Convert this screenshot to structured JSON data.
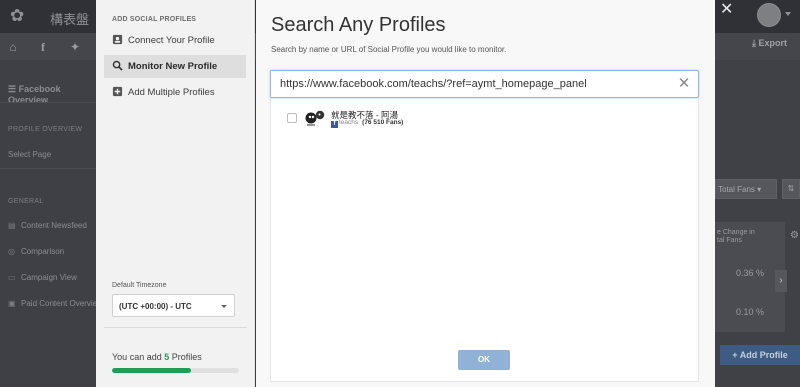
{
  "background": {
    "brand_text": "構表盤",
    "export_label": "Export",
    "left_nav": {
      "title": "Facebook Overview",
      "section_profile": "PROFILE OVERVIEW",
      "select_page": "Select Page",
      "section_general": "GENERAL",
      "items": [
        {
          "label": "Content Newsfeed",
          "icon": "newsfeed-icon"
        },
        {
          "label": "Comparison",
          "icon": "comparison-icon"
        },
        {
          "label": "Campaign View",
          "icon": "campaign-icon"
        },
        {
          "label": "Paid Content Overview",
          "icon": "paid-content-icon"
        }
      ]
    },
    "right_panel": {
      "select_label": "Total Fans",
      "column_header_line1": "e Change in",
      "column_header_line2": "tal Fans",
      "values": [
        "0.36 %",
        "0.10 %"
      ],
      "add_profile_label": "+ Add Profile"
    }
  },
  "modal": {
    "nav_title": "ADD SOCIAL PROFILES",
    "nav_items": [
      {
        "label": "Connect Your Profile",
        "icon": "profile-card-icon",
        "active": false
      },
      {
        "label": "Monitor New Profile",
        "icon": "search-icon",
        "active": true
      },
      {
        "label": "Add Multiple Profiles",
        "icon": "add-multiple-icon",
        "active": false
      }
    ],
    "timezone_label": "Default Timezone",
    "timezone_value": "(UTC +00:00) - UTC",
    "quota_prefix": "You can add ",
    "quota_count": "5",
    "quota_suffix": " Profiles",
    "quota_progress": 0.62,
    "title": "Search Any Profiles",
    "subtitle": "Search by name or URL of Social Profile you would like to monitor.",
    "search_value": "https://www.facebook.com/teachs/?ref=aymt_homepage_panel",
    "results": [
      {
        "name": "就是教不落 - 阿湯",
        "network_badge": "f",
        "handle": "teachs",
        "fans": "(76 510 Fans)"
      }
    ],
    "ok_label": "OK",
    "close_label": "✕"
  },
  "colors": {
    "accent_green": "#1f9d55",
    "ok_button": "#8fb2d6",
    "facebook_blue": "#3b5998"
  }
}
